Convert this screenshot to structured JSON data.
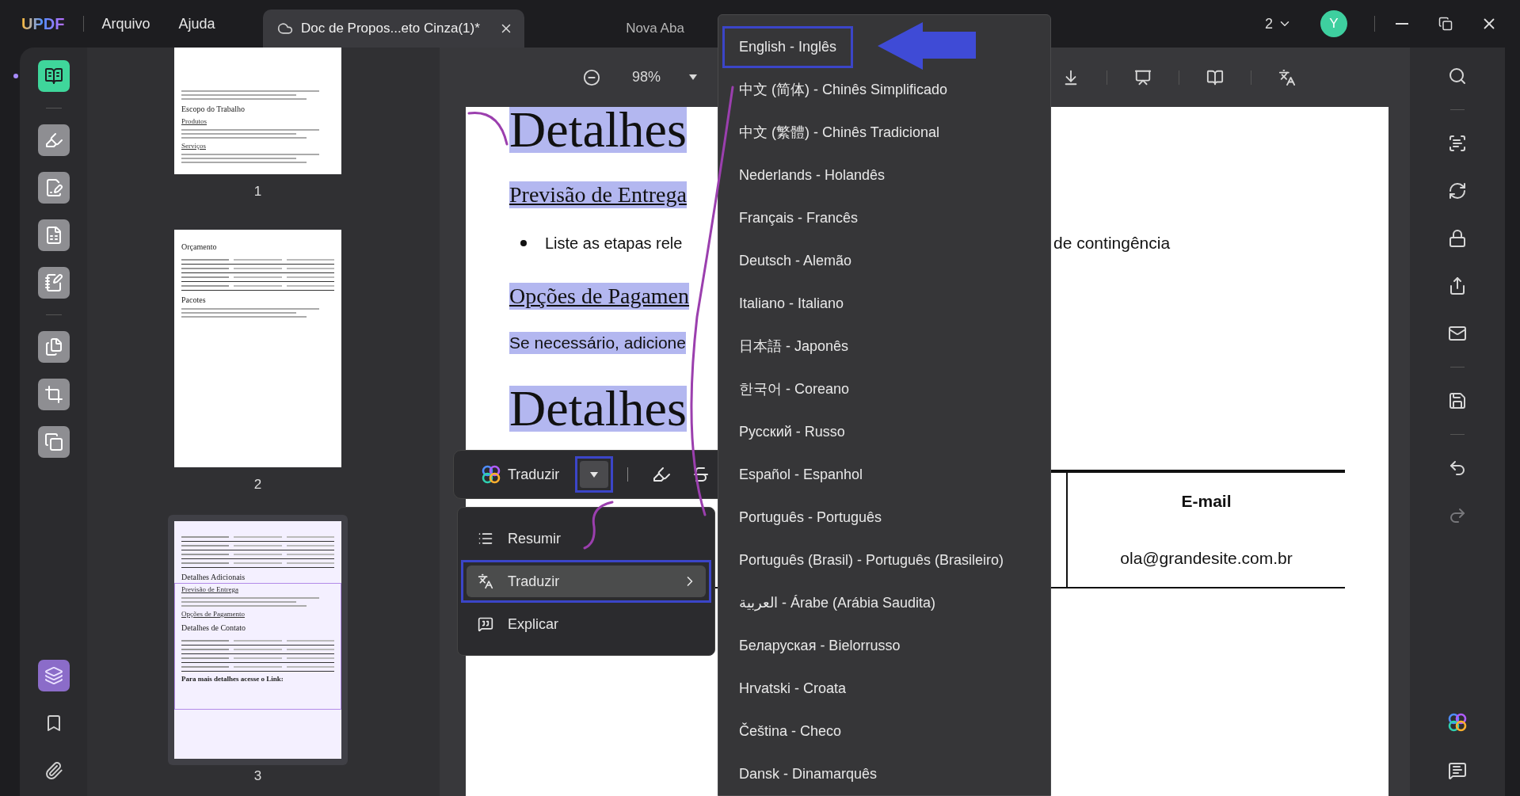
{
  "title_bar": {
    "logo": "UPDF",
    "menus": [
      "Arquivo",
      "Ajuda"
    ],
    "tabs": [
      {
        "label": "Doc de Propos...eto Cinza(1)*",
        "selected": true
      },
      {
        "label": "Nova Aba",
        "selected": false
      }
    ],
    "page_count": "2",
    "avatar": "Y"
  },
  "left_rail": {
    "tools": [
      {
        "selected": true
      },
      {
        "selected": false
      },
      {
        "selected": false
      },
      {
        "selected": false
      },
      {
        "selected": false
      },
      {
        "selected": false
      },
      {
        "selected": false
      },
      {
        "selected": false
      }
    ],
    "panels": [
      {
        "selected": true
      },
      {
        "selected": false
      },
      {
        "selected": false
      }
    ]
  },
  "thumbnails": [
    {
      "page": "1",
      "selected": false,
      "blocks": [
        {
          "kind": "lines"
        },
        {
          "kind": "title",
          "text": "Escopo do Trabalho"
        },
        {
          "kind": "link",
          "text": "Produtos"
        },
        {
          "kind": "lines"
        },
        {
          "kind": "link",
          "text": "Serviços"
        },
        {
          "kind": "lines"
        }
      ]
    },
    {
      "page": "2",
      "selected": false,
      "blocks": [
        {
          "kind": "title",
          "text": "Orçamento"
        },
        {
          "kind": "table"
        },
        {
          "kind": "title",
          "text": "Pacotes"
        },
        {
          "kind": "lines"
        }
      ]
    },
    {
      "page": "3",
      "selected": true,
      "blocks": [
        {
          "kind": "table"
        },
        {
          "kind": "title",
          "text": "Detalhes Adicionais"
        },
        {
          "kind": "link",
          "text": "Previsão de Entrega"
        },
        {
          "kind": "lines"
        },
        {
          "kind": "link",
          "text": "Opções de Pagamento"
        },
        {
          "kind": "title",
          "text": "Detalhes de Contato"
        },
        {
          "kind": "table"
        },
        {
          "kind": "note",
          "text": "Para mais detalhes acesse o Link:"
        }
      ]
    }
  ],
  "toolbar": {
    "zoom": "98%"
  },
  "document": {
    "blocks": [
      {
        "kind": "heading",
        "text": "Detalhes",
        "highlighted": true
      },
      {
        "kind": "subheading",
        "text": "Previsão de Entrega",
        "highlighted": true
      },
      {
        "kind": "bullet",
        "text": "Liste as etapas rele",
        "tail": "de contingência",
        "highlighted": false
      },
      {
        "kind": "subheading",
        "text": "Opções de Pagamen",
        "highlighted": true
      },
      {
        "kind": "paragraph",
        "text": "Se necessário, adicione",
        "highlighted": true
      },
      {
        "kind": "heading",
        "text": "Detalhes",
        "highlighted": true
      }
    ],
    "table": {
      "column_3": {
        "header": "E-mail",
        "cells": [
          "ola@grandesite.com.br"
        ]
      }
    }
  },
  "floating_toolbar": {
    "label": "Traduzir",
    "dropdown_marked": true
  },
  "context_menu": [
    {
      "label": "Resumir",
      "selected": false,
      "marked": false,
      "has_submenu": false
    },
    {
      "label": "Traduzir",
      "selected": true,
      "marked": true,
      "has_submenu": true
    },
    {
      "label": "Explicar",
      "selected": false,
      "marked": false,
      "has_submenu": false
    }
  ],
  "language_menu": [
    {
      "label": "English - Inglês",
      "marked": true
    },
    {
      "label": "中文 (简体) - Chinês Simplificado",
      "marked": false
    },
    {
      "label": "中文 (繁體) - Chinês Tradicional",
      "marked": false
    },
    {
      "label": "Nederlands - Holandês",
      "marked": false
    },
    {
      "label": "Français - Francês",
      "marked": false
    },
    {
      "label": "Deutsch - Alemão",
      "marked": false
    },
    {
      "label": "Italiano - Italiano",
      "marked": false
    },
    {
      "label": "日本語 - Japonês",
      "marked": false
    },
    {
      "label": "한국어 - Coreano",
      "marked": false
    },
    {
      "label": "Русский - Russo",
      "marked": false
    },
    {
      "label": "Español - Espanhol",
      "marked": false
    },
    {
      "label": "Português - Português",
      "marked": false
    },
    {
      "label": "Português (Brasil) - Português (Brasileiro)",
      "marked": false
    },
    {
      "label": "العربية - Árabe (Arábia Saudita)",
      "marked": false
    },
    {
      "label": "Беларуская - Bielorrusso",
      "marked": false
    },
    {
      "label": "Hrvatski - Croata",
      "marked": false
    },
    {
      "label": "Čeština - Checo",
      "marked": false
    },
    {
      "label": "Dansk - Dinamarquês",
      "marked": false
    }
  ],
  "right_rail": {
    "redo": {
      "disabled": true
    }
  }
}
